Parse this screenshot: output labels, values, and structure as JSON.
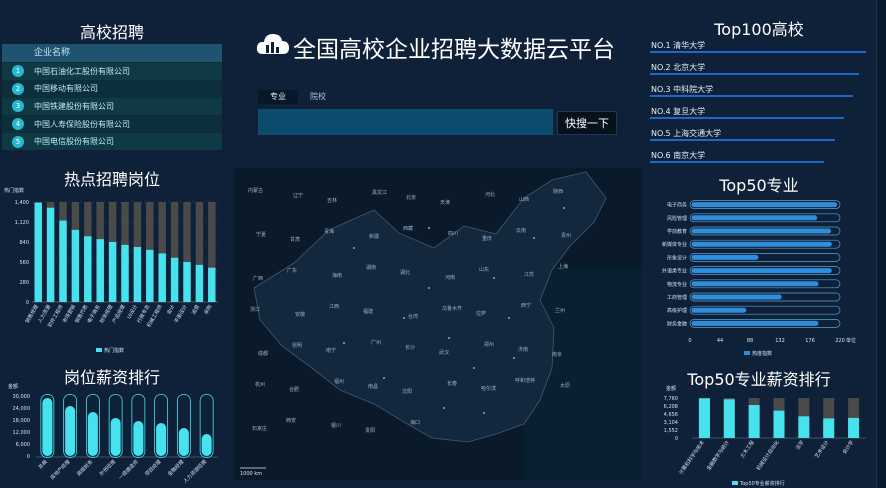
{
  "left": {
    "title": "高校招聘",
    "table": {
      "header": "企业名称",
      "rows": [
        {
          "idx": "1",
          "name": "中国石油化工股份有限公司"
        },
        {
          "idx": "2",
          "name": "中国移动有限公司"
        },
        {
          "idx": "3",
          "name": "中国铁建股份有限公司"
        },
        {
          "idx": "4",
          "name": "中国人寿保险股份有限公司"
        },
        {
          "idx": "5",
          "name": "中国电信股份有限公司"
        }
      ]
    },
    "hot_title": "热点招聘岗位",
    "salary_title": "岗位薪资排行"
  },
  "center": {
    "brand": "全国高校企业招聘大数据云平台",
    "tabs": [
      {
        "label": "专业",
        "active": true
      },
      {
        "label": "院校",
        "active": false
      }
    ],
    "search_value": "",
    "search_button": "快搜一下",
    "map_scale": "1000 km",
    "map_labels": [
      "内蒙古",
      "辽宁",
      "吉林",
      "黑龙江",
      "北京",
      "天津",
      "河北",
      "山西",
      "陕西",
      "宁夏",
      "甘肃",
      "青海",
      "新疆",
      "西藏",
      "四川",
      "重庆",
      "云南",
      "贵州",
      "广西",
      "广东",
      "海南",
      "湖南",
      "湖北",
      "河南",
      "山东",
      "江苏",
      "上海",
      "浙江",
      "安徽",
      "江西",
      "福建",
      "台湾",
      "乌鲁木齐",
      "拉萨",
      "西宁",
      "兰州",
      "成都",
      "昆明",
      "南宁",
      "广州",
      "长沙",
      "武汉",
      "郑州",
      "济南",
      "南京",
      "杭州",
      "合肥",
      "福州",
      "南昌",
      "沈阳",
      "长春",
      "哈尔滨",
      "呼和浩特",
      "太原",
      "石家庄",
      "西安",
      "银川",
      "贵阳",
      "海口"
    ]
  },
  "right": {
    "top100_title": "Top100高校",
    "top100": [
      {
        "rank": "NO.1",
        "name": "清华大学",
        "pct": 99
      },
      {
        "rank": "NO.2",
        "name": "北京大学",
        "pct": 96
      },
      {
        "rank": "NO.3",
        "name": "中科院大学",
        "pct": 93
      },
      {
        "rank": "NO.4",
        "name": "复旦大学",
        "pct": 89
      },
      {
        "rank": "NO.5",
        "name": "上海交通大学",
        "pct": 85
      },
      {
        "rank": "NO.6",
        "name": "南京大学",
        "pct": 80
      }
    ],
    "top50_title": "Top50专业",
    "top50_salary_title": "Top50专业薪资排行"
  },
  "chart_data": [
    {
      "type": "bar",
      "id": "hot-jobs",
      "ylabel": "热门指数",
      "ylim": [
        0,
        1400
      ],
      "yticks": [
        0,
        280,
        560,
        840,
        1120,
        1400
      ],
      "legend": "热门指数",
      "categories": [
        "销售经理",
        "人力资源",
        "软件工程师",
        "市场营销",
        "销售代表",
        "电子商务",
        "财务经理",
        "产品经理",
        "UI设计",
        "行政专员",
        "机械工程师",
        "会计",
        "平面设计",
        "运营",
        "采购"
      ],
      "values": [
        1390,
        1320,
        1140,
        1010,
        920,
        880,
        840,
        800,
        770,
        730,
        680,
        620,
        560,
        520,
        480
      ],
      "max": 1400
    },
    {
      "type": "bar",
      "id": "job-salary",
      "ylabel": "金额",
      "ylim": [
        0,
        30000
      ],
      "yticks": [
        0,
        6000,
        12000,
        18000,
        24000,
        30000
      ],
      "ytick_labels": [
        "0",
        "6,000",
        "12,000",
        "18,000",
        "24,000",
        "30,000"
      ],
      "categories": [
        "总裁",
        "房地产经理",
        "高级财务",
        "外贸经理",
        "一级建造师",
        "项目经理",
        "金融经理",
        "人力资源经理"
      ],
      "values": [
        29000,
        25000,
        22000,
        19000,
        17500,
        16500,
        14000,
        11000
      ]
    },
    {
      "type": "bar",
      "id": "top50-major",
      "orientation": "horizontal",
      "xlim": [
        0,
        220
      ],
      "xticks": [
        0,
        44,
        88,
        132,
        176,
        220
      ],
      "unit": "单位",
      "legend": "热度指数",
      "categories": [
        "电子商务",
        "风险管理",
        "学前教育",
        "新媒体专业",
        "形象设计",
        "外语类专业",
        "物流专业",
        "工商管理",
        "高级护理",
        "财务金融"
      ],
      "values": [
        218,
        188,
        209,
        210,
        100,
        210,
        190,
        135,
        82,
        190
      ]
    },
    {
      "type": "bar",
      "id": "top50-salary",
      "ylabel": "金额",
      "ytick_labels": [
        "0",
        "1,552",
        "3,104",
        "4,656",
        "6,208",
        "7,760"
      ],
      "legend": "Top50专业薪资排行",
      "categories": [
        "计算机科学与技术",
        "金融数学与统计",
        "土木工程",
        "机械设计自动化",
        "法学",
        "艺术设计",
        "会计学"
      ],
      "values": [
        7700,
        7500,
        6400,
        5300,
        4200,
        3800,
        3900
      ],
      "max": 7760
    }
  ]
}
